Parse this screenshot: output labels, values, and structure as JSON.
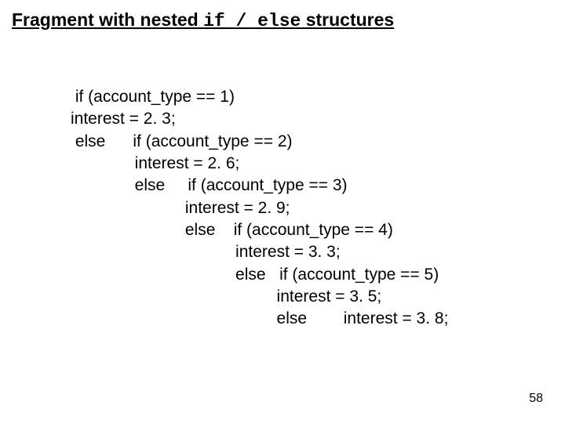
{
  "title": {
    "part1": "Fragment with nested ",
    "mono": "if / else",
    "part2": " structures"
  },
  "code": {
    "l1": " if (account_type == 1)",
    "l2": "interest = 2. 3;",
    "l3": " else      if (account_type == 2)",
    "l4": "              interest = 2. 6;",
    "l5": "              else     if (account_type == 3)",
    "l6": "                         interest = 2. 9;",
    "l7": "                         else    if (account_type == 4)",
    "l8": "                                    interest = 3. 3;",
    "l9": "                                    else   if (account_type == 5)",
    "l10": "                                             interest = 3. 5;",
    "l11": "                                             else        interest = 3. 8;"
  },
  "pagenum": "58"
}
